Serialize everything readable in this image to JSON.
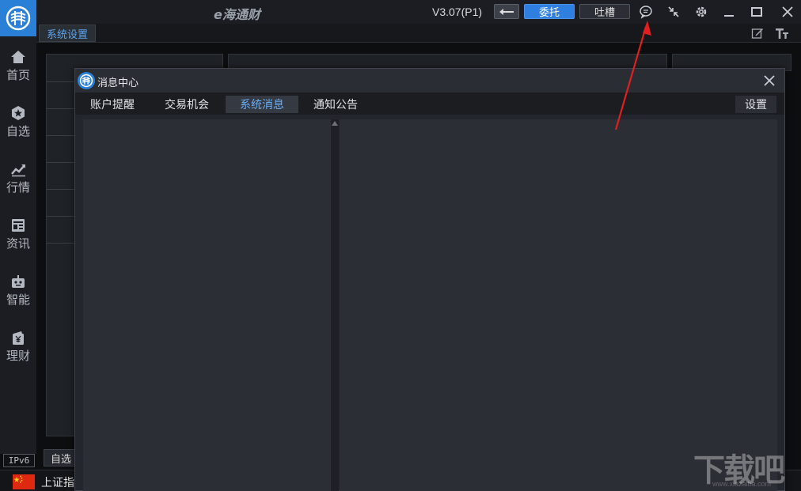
{
  "titlebar": {
    "app_title": "e海通财",
    "version": "V3.07(P1)",
    "entrust_label": "委托",
    "feedback_label": "吐槽"
  },
  "subbar": {
    "tab_label": "系统设置"
  },
  "sidebar": {
    "items": [
      {
        "label": "首页",
        "icon": "home-icon"
      },
      {
        "label": "自选",
        "icon": "star-icon"
      },
      {
        "label": "行情",
        "icon": "chart-icon"
      },
      {
        "label": "资讯",
        "icon": "news-icon"
      },
      {
        "label": "智能",
        "icon": "robot-icon"
      },
      {
        "label": "理财",
        "icon": "wallet-icon"
      }
    ],
    "ipv6_label": "IPv6"
  },
  "background": {
    "bottom_tab": "自选",
    "status_text": "上证指"
  },
  "dialog": {
    "title": "消息中心",
    "tabs": [
      {
        "label": "账户提醒",
        "active": false
      },
      {
        "label": "交易机会",
        "active": false
      },
      {
        "label": "系统消息",
        "active": true
      },
      {
        "label": "通知公告",
        "active": false
      }
    ],
    "settings_label": "设置"
  },
  "colors": {
    "accent": "#2f7fe0",
    "active_tab_text": "#6aaef5",
    "annotation_arrow": "#e02020"
  },
  "watermark": {
    "text": "下载吧",
    "sub": "www.xiazaiba.com"
  }
}
